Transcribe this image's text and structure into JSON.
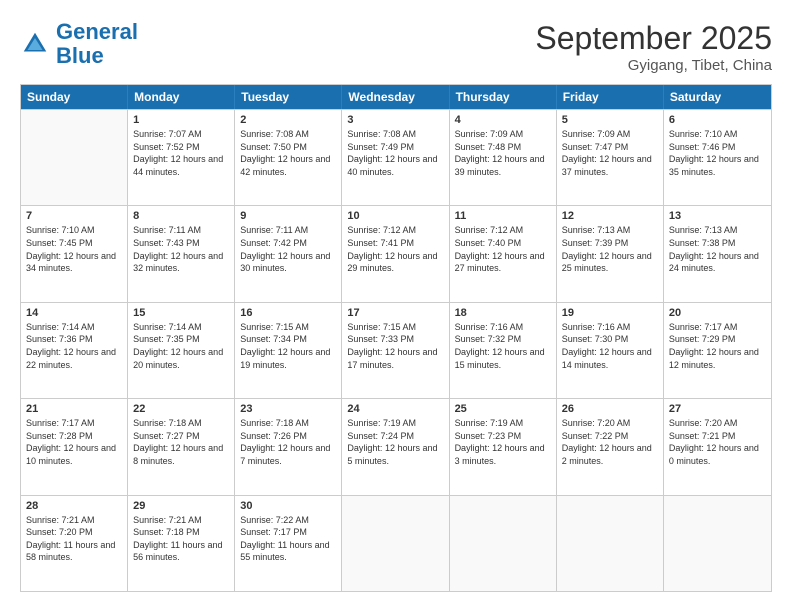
{
  "logo": {
    "text_general": "General",
    "text_blue": "Blue"
  },
  "title": "September 2025",
  "location": "Gyigang, Tibet, China",
  "header_days": [
    "Sunday",
    "Monday",
    "Tuesday",
    "Wednesday",
    "Thursday",
    "Friday",
    "Saturday"
  ],
  "weeks": [
    [
      {
        "day": "",
        "sunrise": "",
        "sunset": "",
        "daylight": ""
      },
      {
        "day": "1",
        "sunrise": "Sunrise: 7:07 AM",
        "sunset": "Sunset: 7:52 PM",
        "daylight": "Daylight: 12 hours and 44 minutes."
      },
      {
        "day": "2",
        "sunrise": "Sunrise: 7:08 AM",
        "sunset": "Sunset: 7:50 PM",
        "daylight": "Daylight: 12 hours and 42 minutes."
      },
      {
        "day": "3",
        "sunrise": "Sunrise: 7:08 AM",
        "sunset": "Sunset: 7:49 PM",
        "daylight": "Daylight: 12 hours and 40 minutes."
      },
      {
        "day": "4",
        "sunrise": "Sunrise: 7:09 AM",
        "sunset": "Sunset: 7:48 PM",
        "daylight": "Daylight: 12 hours and 39 minutes."
      },
      {
        "day": "5",
        "sunrise": "Sunrise: 7:09 AM",
        "sunset": "Sunset: 7:47 PM",
        "daylight": "Daylight: 12 hours and 37 minutes."
      },
      {
        "day": "6",
        "sunrise": "Sunrise: 7:10 AM",
        "sunset": "Sunset: 7:46 PM",
        "daylight": "Daylight: 12 hours and 35 minutes."
      }
    ],
    [
      {
        "day": "7",
        "sunrise": "Sunrise: 7:10 AM",
        "sunset": "Sunset: 7:45 PM",
        "daylight": "Daylight: 12 hours and 34 minutes."
      },
      {
        "day": "8",
        "sunrise": "Sunrise: 7:11 AM",
        "sunset": "Sunset: 7:43 PM",
        "daylight": "Daylight: 12 hours and 32 minutes."
      },
      {
        "day": "9",
        "sunrise": "Sunrise: 7:11 AM",
        "sunset": "Sunset: 7:42 PM",
        "daylight": "Daylight: 12 hours and 30 minutes."
      },
      {
        "day": "10",
        "sunrise": "Sunrise: 7:12 AM",
        "sunset": "Sunset: 7:41 PM",
        "daylight": "Daylight: 12 hours and 29 minutes."
      },
      {
        "day": "11",
        "sunrise": "Sunrise: 7:12 AM",
        "sunset": "Sunset: 7:40 PM",
        "daylight": "Daylight: 12 hours and 27 minutes."
      },
      {
        "day": "12",
        "sunrise": "Sunrise: 7:13 AM",
        "sunset": "Sunset: 7:39 PM",
        "daylight": "Daylight: 12 hours and 25 minutes."
      },
      {
        "day": "13",
        "sunrise": "Sunrise: 7:13 AM",
        "sunset": "Sunset: 7:38 PM",
        "daylight": "Daylight: 12 hours and 24 minutes."
      }
    ],
    [
      {
        "day": "14",
        "sunrise": "Sunrise: 7:14 AM",
        "sunset": "Sunset: 7:36 PM",
        "daylight": "Daylight: 12 hours and 22 minutes."
      },
      {
        "day": "15",
        "sunrise": "Sunrise: 7:14 AM",
        "sunset": "Sunset: 7:35 PM",
        "daylight": "Daylight: 12 hours and 20 minutes."
      },
      {
        "day": "16",
        "sunrise": "Sunrise: 7:15 AM",
        "sunset": "Sunset: 7:34 PM",
        "daylight": "Daylight: 12 hours and 19 minutes."
      },
      {
        "day": "17",
        "sunrise": "Sunrise: 7:15 AM",
        "sunset": "Sunset: 7:33 PM",
        "daylight": "Daylight: 12 hours and 17 minutes."
      },
      {
        "day": "18",
        "sunrise": "Sunrise: 7:16 AM",
        "sunset": "Sunset: 7:32 PM",
        "daylight": "Daylight: 12 hours and 15 minutes."
      },
      {
        "day": "19",
        "sunrise": "Sunrise: 7:16 AM",
        "sunset": "Sunset: 7:30 PM",
        "daylight": "Daylight: 12 hours and 14 minutes."
      },
      {
        "day": "20",
        "sunrise": "Sunrise: 7:17 AM",
        "sunset": "Sunset: 7:29 PM",
        "daylight": "Daylight: 12 hours and 12 minutes."
      }
    ],
    [
      {
        "day": "21",
        "sunrise": "Sunrise: 7:17 AM",
        "sunset": "Sunset: 7:28 PM",
        "daylight": "Daylight: 12 hours and 10 minutes."
      },
      {
        "day": "22",
        "sunrise": "Sunrise: 7:18 AM",
        "sunset": "Sunset: 7:27 PM",
        "daylight": "Daylight: 12 hours and 8 minutes."
      },
      {
        "day": "23",
        "sunrise": "Sunrise: 7:18 AM",
        "sunset": "Sunset: 7:26 PM",
        "daylight": "Daylight: 12 hours and 7 minutes."
      },
      {
        "day": "24",
        "sunrise": "Sunrise: 7:19 AM",
        "sunset": "Sunset: 7:24 PM",
        "daylight": "Daylight: 12 hours and 5 minutes."
      },
      {
        "day": "25",
        "sunrise": "Sunrise: 7:19 AM",
        "sunset": "Sunset: 7:23 PM",
        "daylight": "Daylight: 12 hours and 3 minutes."
      },
      {
        "day": "26",
        "sunrise": "Sunrise: 7:20 AM",
        "sunset": "Sunset: 7:22 PM",
        "daylight": "Daylight: 12 hours and 2 minutes."
      },
      {
        "day": "27",
        "sunrise": "Sunrise: 7:20 AM",
        "sunset": "Sunset: 7:21 PM",
        "daylight": "Daylight: 12 hours and 0 minutes."
      }
    ],
    [
      {
        "day": "28",
        "sunrise": "Sunrise: 7:21 AM",
        "sunset": "Sunset: 7:20 PM",
        "daylight": "Daylight: 11 hours and 58 minutes."
      },
      {
        "day": "29",
        "sunrise": "Sunrise: 7:21 AM",
        "sunset": "Sunset: 7:18 PM",
        "daylight": "Daylight: 11 hours and 56 minutes."
      },
      {
        "day": "30",
        "sunrise": "Sunrise: 7:22 AM",
        "sunset": "Sunset: 7:17 PM",
        "daylight": "Daylight: 11 hours and 55 minutes."
      },
      {
        "day": "",
        "sunrise": "",
        "sunset": "",
        "daylight": ""
      },
      {
        "day": "",
        "sunrise": "",
        "sunset": "",
        "daylight": ""
      },
      {
        "day": "",
        "sunrise": "",
        "sunset": "",
        "daylight": ""
      },
      {
        "day": "",
        "sunrise": "",
        "sunset": "",
        "daylight": ""
      }
    ]
  ]
}
